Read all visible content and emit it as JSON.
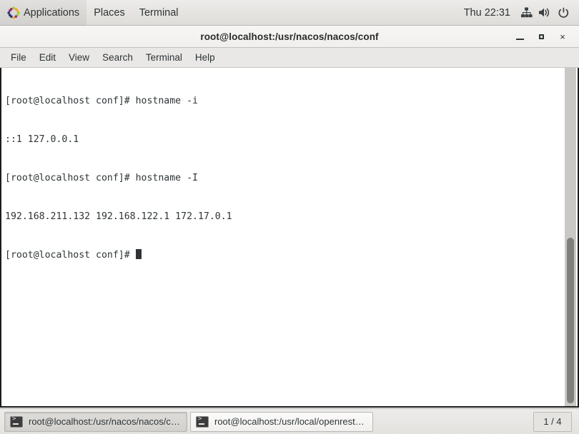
{
  "top_panel": {
    "logo_icon": "centos-pinwheel-icon",
    "menus": [
      {
        "label": "Applications",
        "name": "panel-menu-applications"
      },
      {
        "label": "Places",
        "name": "panel-menu-places"
      },
      {
        "label": "Terminal",
        "name": "panel-menu-terminal"
      }
    ],
    "clock": "Thu 22:31",
    "tray": [
      {
        "icon": "network-wired-icon"
      },
      {
        "icon": "volume-speaker-icon"
      },
      {
        "icon": "power-icon"
      }
    ]
  },
  "window": {
    "title": "root@localhost:/usr/nacos/nacos/conf",
    "controls": {
      "minimize": "minimize-icon",
      "maximize": "maximize-icon",
      "close": "×"
    },
    "menubar": [
      {
        "label": "File",
        "name": "menu-file"
      },
      {
        "label": "Edit",
        "name": "menu-edit"
      },
      {
        "label": "View",
        "name": "menu-view"
      },
      {
        "label": "Search",
        "name": "menu-search"
      },
      {
        "label": "Terminal",
        "name": "menu-terminal"
      },
      {
        "label": "Help",
        "name": "menu-help"
      }
    ]
  },
  "terminal": {
    "prompt": "[root@localhost conf]#",
    "lines": [
      "[root@localhost conf]# hostname -i",
      "::1 127.0.0.1",
      "[root@localhost conf]# hostname -I",
      "192.168.211.132 192.168.122.1 172.17.0.1"
    ],
    "last_prompt": "[root@localhost conf]# ",
    "background_color": "#ffffff",
    "text_color": "#2e3436"
  },
  "taskbar": {
    "buttons": [
      {
        "label": "root@localhost:/usr/nacos/nacos/co…",
        "icon": "terminal-icon",
        "state": "active"
      },
      {
        "label": "root@localhost:/usr/local/openresty…",
        "icon": "terminal-icon",
        "state": "inactive"
      }
    ],
    "workspace": "1 / 4"
  }
}
